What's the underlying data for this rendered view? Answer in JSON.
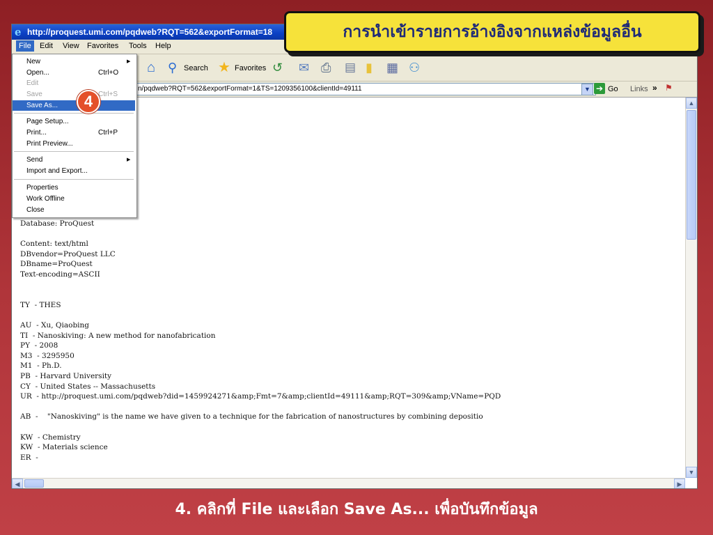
{
  "slide": {
    "heading": "การนำเข้ารายการอ้างอิงจากแหล่งข้อมูลอื่น",
    "caption": "4. คลิกที่ File และเลือก Save As... เพื่อบันทึกข้อมูล",
    "step_number": "4",
    "colors": {
      "background": "#a32a2e",
      "heading_bg": "#f6e23a",
      "heading_text": "#1f2a78",
      "badge": "#e4502a"
    }
  },
  "browser": {
    "title": "http://proquest.umi.com/pqdweb?RQT=562&exportFormat=18",
    "menu": [
      "File",
      "Edit",
      "View",
      "Favorites",
      "Tools",
      "Help"
    ],
    "toolbar": {
      "search_label": "Search",
      "favorites_label": "Favorites"
    },
    "address": {
      "value": "n/pqdweb?RQT=562&exportFormat=1&TS=1209356100&clientId=49111",
      "go_label": "Go",
      "links_label": "Links"
    }
  },
  "file_menu": [
    {
      "label": "New",
      "shortcut": "",
      "submenu": true,
      "disabled": false,
      "highlighted": false
    },
    {
      "label": "Open...",
      "shortcut": "Ctrl+O",
      "submenu": false,
      "disabled": false,
      "highlighted": false
    },
    {
      "label": "Edit",
      "shortcut": "",
      "submenu": false,
      "disabled": true,
      "highlighted": false
    },
    {
      "label": "Save",
      "shortcut": "Ctrl+S",
      "submenu": false,
      "disabled": true,
      "highlighted": false
    },
    {
      "label": "Save As...",
      "shortcut": "",
      "submenu": false,
      "disabled": false,
      "highlighted": true
    },
    {
      "label": "Page Setup...",
      "shortcut": "",
      "submenu": false,
      "disabled": false,
      "highlighted": false
    },
    {
      "label": "Print...",
      "shortcut": "Ctrl+P",
      "submenu": false,
      "disabled": false,
      "highlighted": false
    },
    {
      "label": "Print Preview...",
      "shortcut": "",
      "submenu": false,
      "disabled": false,
      "highlighted": false
    },
    {
      "label": "Send",
      "shortcut": "",
      "submenu": true,
      "disabled": false,
      "highlighted": false
    },
    {
      "label": "Import and Export...",
      "shortcut": "",
      "submenu": false,
      "disabled": false,
      "highlighted": false
    },
    {
      "label": "Properties",
      "shortcut": "",
      "submenu": false,
      "disabled": false,
      "highlighted": false
    },
    {
      "label": "Work Offline",
      "shortcut": "",
      "submenu": false,
      "disabled": false,
      "highlighted": false
    },
    {
      "label": "Close",
      "shortcut": "",
      "submenu": false,
      "disabled": false,
      "highlighted": false
    }
  ],
  "content_lines": [
    "Database: ProQuest",
    "",
    "Content: text/html",
    "DBvendor=ProQuest LLC",
    "DBname=ProQuest",
    "Text-encoding=ASCII",
    "",
    "",
    "TY  - THES",
    "",
    "AU  - Xu, Qiaobing",
    "TI  - Nanoskiving: A new method for nanofabrication",
    "PY  - 2008",
    "M3  - 3295950",
    "M1  - Ph.D.",
    "PB  - Harvard University",
    "CY  - United States -- Massachusetts",
    "UR  - http://proquest.umi.com/pqdweb?did=1459924271&amp;Fmt=7&amp;clientId=49111&amp;RQT=309&amp;VName=PQD",
    "",
    "AB  -    \"Nanoskiving\" is the name we have given to a technique for the fabrication of nanostructures by combining depositio",
    "",
    "KW  - Chemistry",
    "KW  - Materials science",
    "ER  -"
  ]
}
